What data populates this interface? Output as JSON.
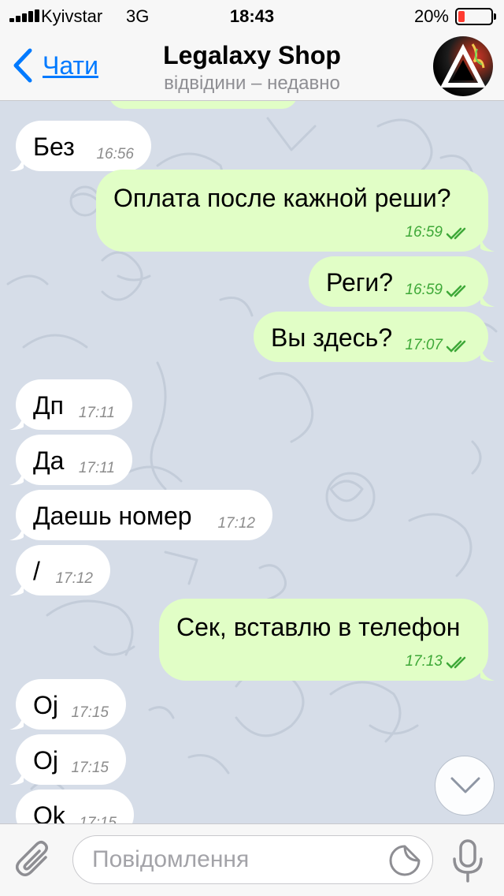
{
  "status_bar": {
    "carrier": "Kyivstar",
    "network": "3G",
    "time": "18:43",
    "battery_percent": "20%",
    "battery_level": 0.2,
    "battery_color": "#ff3b30"
  },
  "header": {
    "back_label": "Чати",
    "title": "Legalaxy Shop",
    "subtitle": "відвідини – недавно"
  },
  "colors": {
    "incoming_bubble": "#ffffff",
    "outgoing_bubble": "#e1fec6",
    "outgoing_time": "#3ea838",
    "accent": "#007aff",
    "chat_background": "#d6dde8"
  },
  "messages": [
    {
      "direction": "in",
      "text": "Без",
      "time": "16:56"
    },
    {
      "direction": "out",
      "text": "Оплата после кажной реши?",
      "time": "16:59",
      "status": "read"
    },
    {
      "direction": "out",
      "text": "Реги?",
      "time": "16:59",
      "status": "read"
    },
    {
      "direction": "out",
      "text": "Вы здесь?",
      "time": "17:07",
      "status": "read"
    },
    {
      "direction": "in",
      "text": "Дп",
      "time": "17:11"
    },
    {
      "direction": "in",
      "text": "Да",
      "time": "17:11"
    },
    {
      "direction": "in",
      "text": "Даешь номер",
      "time": "17:12"
    },
    {
      "direction": "in",
      "text": "/",
      "time": "17:12"
    },
    {
      "direction": "out",
      "text": "Сек, вставлю в телефон",
      "time": "17:13",
      "status": "read"
    },
    {
      "direction": "in",
      "text": "Oj",
      "time": "17:15"
    },
    {
      "direction": "in",
      "text": "Oj",
      "time": "17:15"
    },
    {
      "direction": "in",
      "text": "Ok",
      "time": "17:15"
    }
  ],
  "composer": {
    "placeholder": "Повідомлення",
    "value": ""
  },
  "icons": {
    "back": "chevron-left-icon",
    "attach": "paperclip-icon",
    "sticker": "sticker-icon",
    "mic": "microphone-icon",
    "scroll_down": "chevron-down-icon",
    "read_status": "double-check-icon"
  }
}
